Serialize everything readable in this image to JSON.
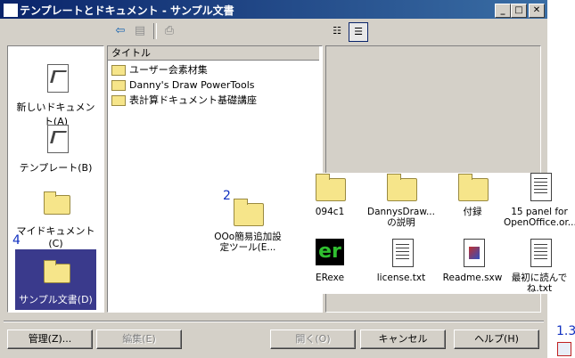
{
  "window": {
    "title": "テンプレートとドキュメント - サンプル文書"
  },
  "titlebar_buttons": {
    "minimize": "_",
    "maximize": "□",
    "close": "✕"
  },
  "toolbar": {
    "back_icon": "⇦",
    "up_icon": "▤",
    "print_icon": "⎙",
    "view_list_icon": "☷",
    "view_detail_icon": "☰"
  },
  "categories": [
    {
      "label": "新しいドキュメント(A)",
      "icon": "new-document-icon"
    },
    {
      "label": "テンプレート(B)",
      "icon": "template-icon"
    },
    {
      "label": "マイドキュメント(C)",
      "icon": "my-documents-folder-icon"
    },
    {
      "label": "サンプル文書(D)",
      "icon": "open-folder-icon",
      "selected": true
    }
  ],
  "list": {
    "column_header": "タイトル",
    "rows": [
      "ユーザー会素材集",
      "Danny's Draw PowerTools",
      "表計算ドキュメント基礎講座"
    ]
  },
  "overlay": {
    "markers": {
      "a": "2",
      "b": "4",
      "c": "1.3"
    },
    "items": [
      {
        "label": "OOo簡易追加設定ツール(E...",
        "type": "folder"
      },
      {
        "label": "094c1",
        "type": "folder"
      },
      {
        "label": "DannysDraw...の説明",
        "type": "folder"
      },
      {
        "label": "付録",
        "type": "folder"
      },
      {
        "label": "15 panel for OpenOffice.or...",
        "type": "text"
      },
      {
        "label": "ERexe",
        "type": "exe"
      },
      {
        "label": "license.txt",
        "type": "text"
      },
      {
        "label": "Readme.sxw",
        "type": "sxw"
      },
      {
        "label": "最初に読んでね.txt",
        "type": "text"
      }
    ]
  },
  "buttons": {
    "manage": "管理(Z)...",
    "edit": "編集(E)",
    "open": "開く(O)",
    "cancel": "キャンセル",
    "help": "ヘルプ(H)"
  }
}
